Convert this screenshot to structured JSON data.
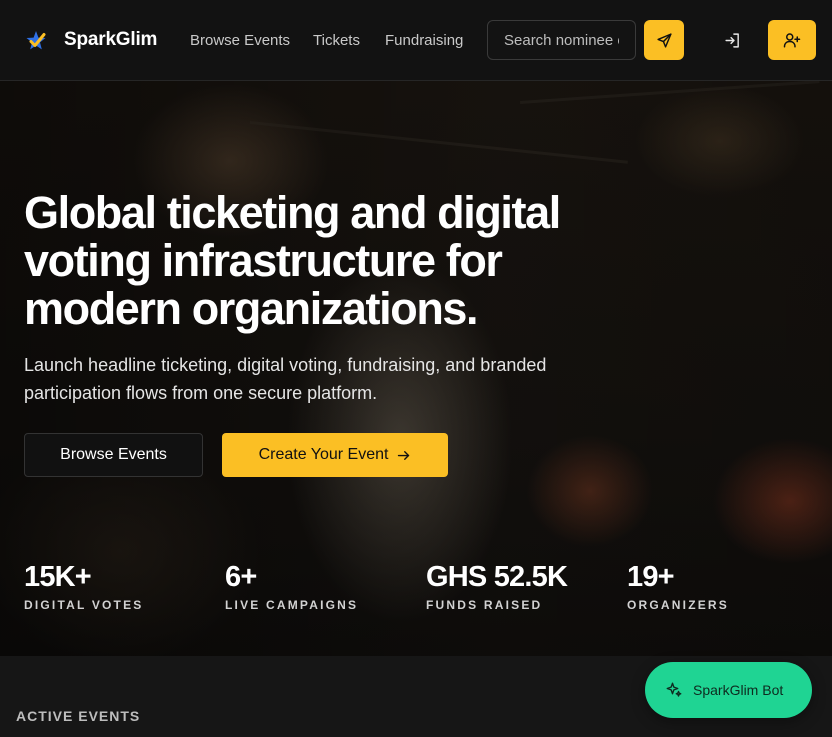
{
  "header": {
    "brand": "SparkGlim",
    "nav": [
      "Browse Events",
      "Tickets",
      "Fundraising"
    ],
    "search_placeholder": "Search nominee or event"
  },
  "hero": {
    "headline": "Global ticketing and digital voting infrastructure for modern organizations.",
    "subtext": "Launch headline ticketing, digital voting, fundraising, and branded participation flows from one secure platform.",
    "browse_button": "Browse Events",
    "create_button": "Create Your Event",
    "stats": [
      {
        "value": "15K+",
        "label": "DIGITAL VOTES"
      },
      {
        "value": "6+",
        "label": "LIVE CAMPAIGNS"
      },
      {
        "value": "GHS 52.5K",
        "label": "FUNDS RAISED"
      },
      {
        "value": "19+",
        "label": "ORGANIZERS"
      }
    ]
  },
  "section": {
    "label": "ACTIVE EVENTS"
  },
  "bot": {
    "label": "SparkGlim Bot"
  },
  "colors": {
    "accent": "#fbbf24",
    "bot": "#1fd493",
    "background": "#161616"
  }
}
